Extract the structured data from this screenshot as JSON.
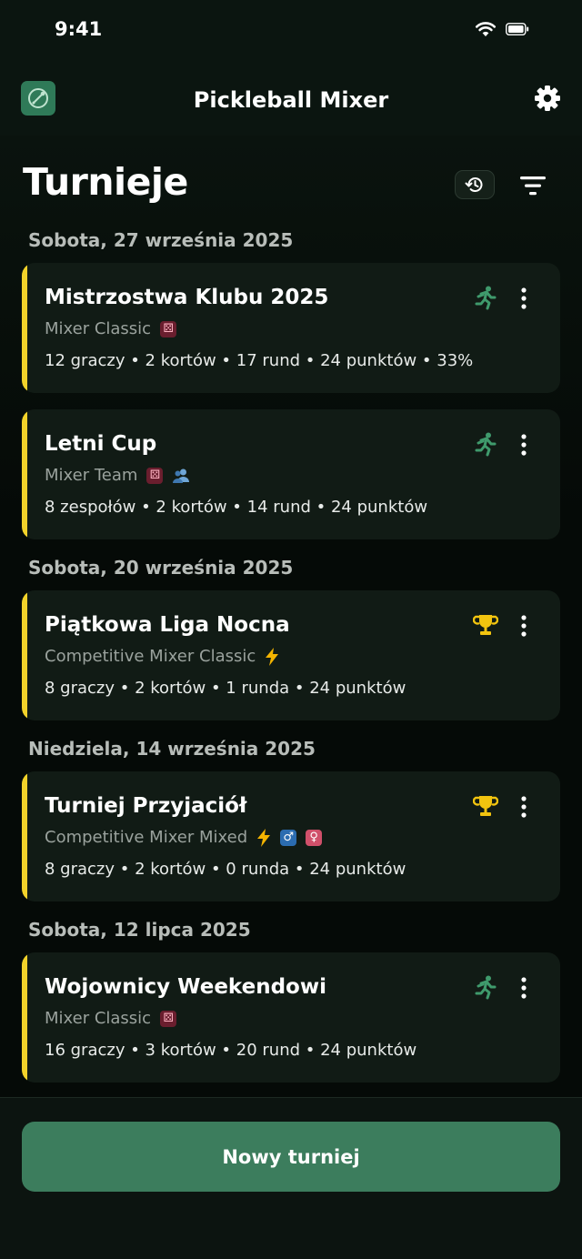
{
  "status_bar": {
    "time": "9:41"
  },
  "header": {
    "title": "Pickleball Mixer"
  },
  "page": {
    "title": "Turnieje"
  },
  "groups": [
    {
      "date": "Sobota, 27 września 2025"
    },
    {
      "date": "Sobota, 20 września 2025"
    },
    {
      "date": "Niedziela, 14 września 2025"
    },
    {
      "date": "Sobota, 12 lipca 2025"
    }
  ],
  "tournaments": [
    {
      "title": "Mistrzostwa Klubu 2025",
      "type": "Mixer Classic",
      "tags": [
        "dice-icon"
      ],
      "stats": "12 graczy  •  2 kortów  •  17 rund  •  24 punktów  •  33%",
      "status_icon": "running-icon"
    },
    {
      "title": "Letni Cup",
      "type": "Mixer Team",
      "tags": [
        "dice-icon",
        "team-icon"
      ],
      "stats": "8 zespołów  •  2 kortów  •  14 rund  •  24 punktów",
      "status_icon": "running-icon"
    },
    {
      "title": "Piątkowa Liga Nocna",
      "type": "Competitive Mixer Classic",
      "tags": [
        "lightning-icon"
      ],
      "stats": "8 graczy  •  2 kortów  •  1 runda  •  24 punktów",
      "status_icon": "trophy-icon"
    },
    {
      "title": "Turniej Przyjaciół",
      "type": "Competitive Mixer Mixed",
      "tags": [
        "lightning-icon",
        "male-icon",
        "female-icon"
      ],
      "stats": "8 graczy  •  2 kortów  •  0 runda  •  24 punktów",
      "status_icon": "trophy-icon"
    },
    {
      "title": "Wojownicy Weekendowi",
      "type": "Mixer Classic",
      "tags": [
        "dice-icon"
      ],
      "stats": "16 graczy  •  3 kortów  •  20 rund  •  24 punktów",
      "status_icon": "running-icon"
    }
  ],
  "footer": {
    "new_button_label": "Nowy turniej"
  },
  "colors": {
    "accent": "#3c7d5d",
    "card_stripe": "#f2d22a",
    "trophy": "#f2c40f",
    "running": "#3f9a6c"
  }
}
